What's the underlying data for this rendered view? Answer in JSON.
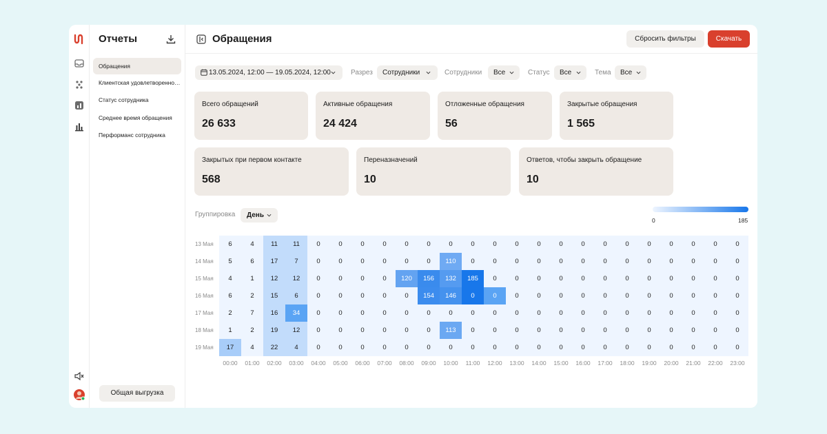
{
  "sidebar": {
    "title": "Отчеты",
    "items": [
      {
        "label": "Обращения",
        "active": true
      },
      {
        "label": "Клиентская удовлетворенность",
        "active": false
      },
      {
        "label": "Статус сотрудника",
        "active": false
      },
      {
        "label": "Среднее время обращения",
        "active": false
      },
      {
        "label": "Перформанс сотрудника",
        "active": false
      }
    ],
    "export_label": "Общая выгрузка"
  },
  "rail_icons": [
    "inbox-icon",
    "apps-icon",
    "widget-icon",
    "bar-chart-icon",
    "mute-icon",
    "avatar"
  ],
  "header": {
    "title": "Обращения",
    "reset_label": "Сбросить фильтры",
    "download_label": "Скачать"
  },
  "filters": {
    "date_range": "13.05.2024, 12:00 — 19.05.2024, 12:00",
    "slice_label": "Разрез",
    "slice_value": "Сотрудники",
    "employees_label": "Сотрудники",
    "employees_value": "Все",
    "status_label": "Статус",
    "status_value": "Все",
    "topic_label": "Тема",
    "topic_value": "Все"
  },
  "stats": [
    {
      "label": "Всего обращений",
      "value": "26 633"
    },
    {
      "label": "Активные обращения",
      "value": "24 424"
    },
    {
      "label": "Отложенные обращения",
      "value": "56"
    },
    {
      "label": "Закрытые обращения",
      "value": "1 565"
    },
    {
      "label": "Закрытых при первом контакте",
      "value": "568"
    },
    {
      "label": "Переназначений",
      "value": "10"
    },
    {
      "label": "Ответов, чтобы закрыть обращение",
      "value": "10"
    }
  ],
  "grouping": {
    "label": "Группировка",
    "value": "День"
  },
  "colors": {
    "accent": "#d9402d",
    "heat_low": "#eef5ff",
    "heat_high": "#1877ea"
  },
  "heatmap": {
    "min_label": "0",
    "max_label": "185",
    "min": 0,
    "max": 185,
    "rows": [
      "13 Мая",
      "14 Мая",
      "15 Мая",
      "16 Мая",
      "17 Мая",
      "18 Мая",
      "19 Мая"
    ],
    "cols": [
      "00:00",
      "01:00",
      "02:00",
      "03:00",
      "04:00",
      "05:00",
      "06:00",
      "07:00",
      "08:00",
      "09:00",
      "10:00",
      "11:00",
      "12:00",
      "13:00",
      "14:00",
      "15:00",
      "16:00",
      "17:00",
      "18:00",
      "19:00",
      "20:00",
      "21:00",
      "22:00",
      "23:00"
    ],
    "values": [
      [
        6,
        4,
        11,
        11,
        0,
        0,
        0,
        0,
        0,
        0,
        0,
        0,
        0,
        0,
        0,
        0,
        0,
        0,
        0,
        0,
        0,
        0,
        0,
        0
      ],
      [
        5,
        6,
        17,
        7,
        0,
        0,
        0,
        0,
        0,
        0,
        110,
        0,
        0,
        0,
        0,
        0,
        0,
        0,
        0,
        0,
        0,
        0,
        0,
        0
      ],
      [
        4,
        1,
        12,
        12,
        0,
        0,
        0,
        0,
        120,
        156,
        132,
        185,
        0,
        0,
        0,
        0,
        0,
        0,
        0,
        0,
        0,
        0,
        0,
        0
      ],
      [
        6,
        2,
        15,
        6,
        0,
        0,
        0,
        0,
        0,
        154,
        146,
        0,
        0,
        0,
        0,
        0,
        0,
        0,
        0,
        0,
        0,
        0,
        0,
        0
      ],
      [
        2,
        7,
        16,
        34,
        0,
        0,
        0,
        0,
        0,
        0,
        0,
        0,
        0,
        0,
        0,
        0,
        0,
        0,
        0,
        0,
        0,
        0,
        0,
        0
      ],
      [
        1,
        2,
        19,
        12,
        0,
        0,
        0,
        0,
        0,
        0,
        113,
        0,
        0,
        0,
        0,
        0,
        0,
        0,
        0,
        0,
        0,
        0,
        0,
        0
      ],
      [
        17,
        4,
        22,
        4,
        0,
        0,
        0,
        0,
        0,
        0,
        0,
        0,
        0,
        0,
        0,
        0,
        0,
        0,
        0,
        0,
        0,
        0,
        0,
        0
      ]
    ],
    "highlight": {
      "cols": [
        2,
        3
      ],
      "color": "#c2dcfb",
      "cell_colors": [
        {
          "row": 3,
          "col": 11,
          "color": "#1877ea"
        },
        {
          "row": 3,
          "col": 12,
          "color": "#5aa4f4"
        },
        {
          "row": 4,
          "col": 3,
          "color": "#5aa4f4"
        },
        {
          "row": 6,
          "col": 0,
          "color": "#a8cdf9"
        }
      ]
    }
  }
}
